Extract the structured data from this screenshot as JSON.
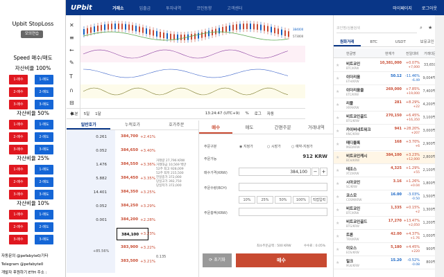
{
  "nav": {
    "logo": "UPbit",
    "menu": [
      "거래소",
      "입출금",
      "투자내역",
      "코인동향",
      "고객센터"
    ],
    "right": [
      "마이페이지",
      "로그아웃"
    ]
  },
  "ext": {
    "title": "Upbit StopLoss",
    "mode_button": "모의연습",
    "speed_title": "Speed 매수/매도",
    "sections": [
      {
        "label": "자산비율 100%"
      },
      {
        "label": "자산비율 50%"
      },
      {
        "label": "자산비율 25%"
      },
      {
        "label": "자산비율 10%"
      }
    ],
    "buy_labels": [
      "1-매수",
      "2-매수",
      "3-매수"
    ],
    "sell_labels": [
      "1-매도",
      "2-매도",
      "3-매도"
    ],
    "credits": [
      "자동문의 @pefabyte0/기타",
      "Telegram @pefabyte0",
      "개발자 후원하기 ETH 주소 :"
    ]
  },
  "chart_bar": {
    "periods": [
      "1분",
      "5일",
      "1달"
    ],
    "time": "13:24:47 (UTC+9)",
    "pct": "%",
    "log": "로그",
    "auto": "자동"
  },
  "chart_labels": {
    "price": "384000",
    "vol": "573000"
  },
  "orderbook": {
    "tabs": [
      "일반호가",
      "누적호가",
      "호가주문"
    ],
    "rows": [
      {
        "qty": "0.261",
        "price": "384,700",
        "pct": "+2.41%"
      },
      {
        "qty": "0.052",
        "price": "384,650",
        "pct": "+3.40%"
      },
      {
        "qty": "1.476",
        "price": "384,550",
        "pct": "+3.36%"
      },
      {
        "qty": "5.882",
        "price": "384,450",
        "pct": "+3.35%"
      },
      {
        "qty": "14.401",
        "price": "384,350",
        "pct": "+3.25%"
      },
      {
        "qty": "0.052",
        "price": "384,250",
        "pct": "+3.29%"
      },
      {
        "qty": "0.001",
        "price": "384,200",
        "pct": "+2.28%"
      },
      {
        "qty": "",
        "price": "384,100",
        "pct": "+3.23%"
      },
      {
        "qty": "",
        "price": "383,900",
        "pct": "+3.22%"
      },
      {
        "qty": "",
        "price": "383,500",
        "pct": "+3.21%"
      }
    ],
    "info": [
      "거래량 27,796 KRW",
      "거래대금 10,569 백만",
      "52주 최고 928,009",
      "52주 최저 215,500",
      "전일종가 372,000",
      "당일고가 392,750",
      "당일저가 372,000"
    ],
    "footer": {
      "pct": "+85.56%",
      "tail": "0.135"
    }
  },
  "orderform": {
    "tabs": [
      "매수",
      "매도",
      "간편주문",
      "거래내역"
    ],
    "type_label": "주문구분",
    "types": [
      "지정가",
      "시장가",
      "예약-지정가"
    ],
    "available_label": "주문가능",
    "available": "912 KRW",
    "price_label": "매수가격(KRW)",
    "price": "384,100",
    "qty_label": "주문수량(BCH)",
    "total_label": "주문총액(KRW)",
    "pct_buttons": [
      "10%",
      "25%",
      "50%",
      "100%",
      "직접입력"
    ],
    "min_order": "최소주문금액 : 500 KRW",
    "fee": "수수료 : 0.05%",
    "reset": "초기화",
    "buy": "매수"
  },
  "market": {
    "search_placeholder": "코인명/심볼검색",
    "tabs": [
      "원화거래",
      "BTC",
      "USDT",
      "보유코인"
    ],
    "head": [
      "한글명",
      "현재가",
      "전일대비",
      "거래대금"
    ],
    "rows": [
      {
        "name": "비트코인",
        "code": "BTC/KRW",
        "price": "10,381,000",
        "ch": "+0.07%",
        "ch2": "+7,000",
        "vol": "33,659백만",
        "dir": "up"
      },
      {
        "name": "이더리움",
        "code": "ETH/KRW",
        "price": "50.12",
        "ch": "-11.46%",
        "ch2": "-6.49",
        "vol": "9,004백만",
        "dir": "dn"
      },
      {
        "name": "이더리움클",
        "code": "ETC/KRW",
        "price": "269,000",
        "ch": "+7.85%",
        "ch2": "+19,000",
        "vol": "7,400백만",
        "dir": "up"
      },
      {
        "name": "리플",
        "code": "XRP/KRW",
        "price": "281",
        "ch": "+8.29%",
        "ch2": "+22",
        "vol": "4,200백만",
        "dir": "up"
      },
      {
        "name": "비트코인골드",
        "code": "BTG/KRW",
        "price": "270,150",
        "ch": "+6.45%",
        "ch2": "+16,350",
        "vol": "3,100백만",
        "dir": "up"
      },
      {
        "name": "카이버네트워크",
        "code": "KNC/KRW",
        "price": "941",
        "ch": "+28.20%",
        "ch2": "+207",
        "vol": "3,000백만",
        "dir": "up"
      },
      {
        "name": "메디블록",
        "code": "MED/KRW",
        "price": "168",
        "ch": "+3.70%",
        "ch2": "+6",
        "vol": "2,900백만",
        "dir": "up"
      },
      {
        "name": "비트코인캐시",
        "code": "BCH/KRW",
        "price": "384,100",
        "ch": "+3.23%",
        "ch2": "+12,000",
        "vol": "2,800백만",
        "dir": "up",
        "hl": true
      },
      {
        "name": "테조스",
        "code": "XTZ/KRW",
        "price": "4,325",
        "ch": "+1.29%",
        "ch2": "+55",
        "vol": "2,100백만",
        "dir": "up"
      },
      {
        "name": "시아코인",
        "code": "SC/KRW",
        "price": "3.16",
        "ch": "+1.26%",
        "ch2": "+0.04",
        "vol": "1,800백만",
        "dir": "up"
      },
      {
        "name": "코스모",
        "code": "COSM/KRW",
        "price": "16.00",
        "ch": "-3.03%",
        "ch2": "-0.50",
        "vol": "1,500백만",
        "dir": "dn"
      },
      {
        "name": "비트코인",
        "code": "BTC/KRW",
        "price": "1,335",
        "ch": "+0.15%",
        "ch2": "+2",
        "vol": "1,300백만",
        "dir": "up"
      },
      {
        "name": "비트코인골드",
        "code": "BTG/KRW",
        "price": "17,270",
        "ch": "+13.47%",
        "ch2": "+2,050",
        "vol": "1,200백만",
        "dir": "up"
      },
      {
        "name": "트론",
        "code": "TRX/KRW",
        "price": "42.00",
        "ch": "+4.37%",
        "ch2": "+1.76",
        "vol": "1,000백만",
        "dir": "up"
      },
      {
        "name": "이오스",
        "code": "EOS/KRW",
        "price": "5,180",
        "ch": "+4.45%",
        "ch2": "+220",
        "vol": "900백만",
        "dir": "up"
      },
      {
        "name": "밀크",
        "code": "MLK/KRW",
        "price": "15.20",
        "ch": "-0.52%",
        "ch2": "-0.08",
        "vol": "800백만",
        "dir": "dn"
      }
    ]
  }
}
